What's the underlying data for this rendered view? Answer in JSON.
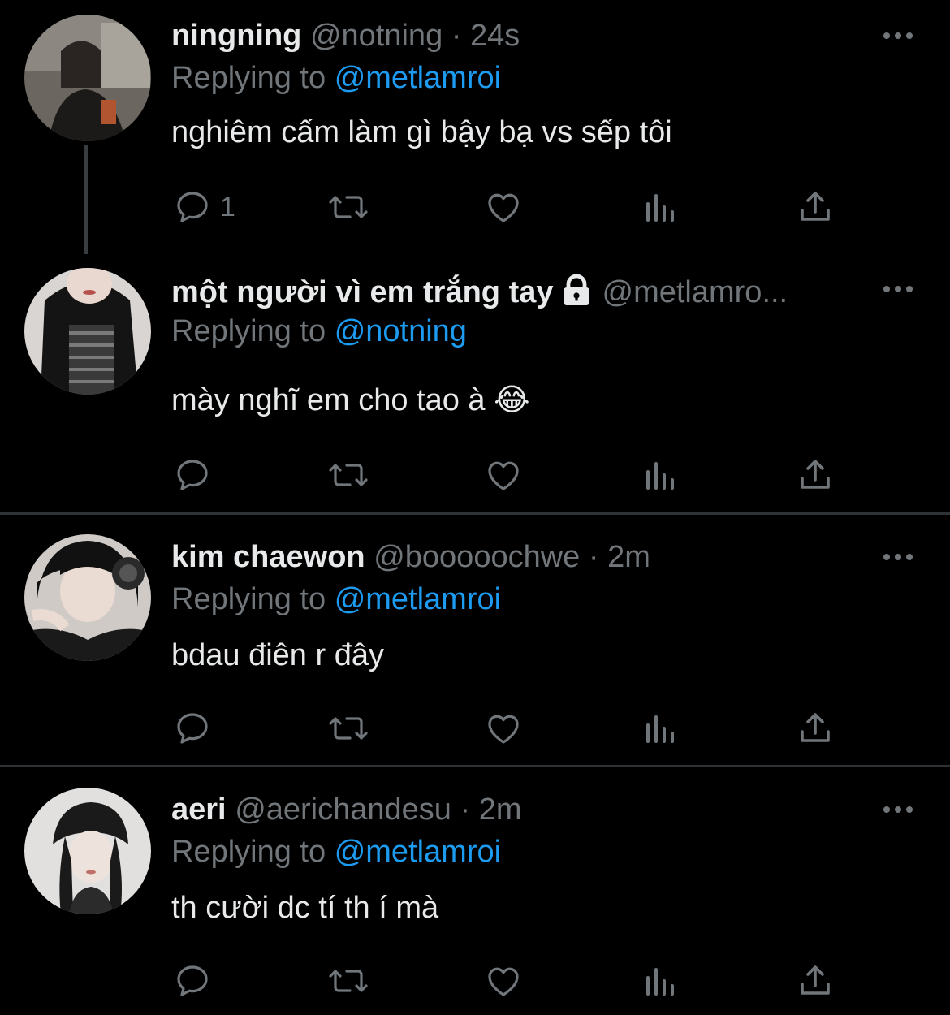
{
  "tweets": [
    {
      "name": "ningning",
      "handle": "@notning",
      "time": "· 24s",
      "replying_prefix": "Replying to",
      "replying_to": "@metlamroi",
      "text": "nghiêm cấm làm gì bậy bạ vs sếp tôi",
      "reply_count": "1"
    },
    {
      "name": "một người vì em trắng tay",
      "handle": "@metlamro...",
      "time": "",
      "protected": true,
      "replying_prefix": "Replying to",
      "replying_to": "@notning",
      "text": "mày nghĩ em cho tao à 😂",
      "reply_count": ""
    },
    {
      "name": "kim chaewon",
      "handle": "@booooochwe",
      "time": "· 2m",
      "replying_prefix": "Replying to",
      "replying_to": "@metlamroi",
      "text": "bdau điên r đây",
      "reply_count": ""
    },
    {
      "name": "aeri",
      "handle": "@aerichandesu",
      "time": "· 2m",
      "replying_prefix": "Replying to",
      "replying_to": "@metlamroi",
      "text": "th cười dc tí th í mà",
      "reply_count": ""
    }
  ],
  "icons": {
    "reply": "reply-icon",
    "retweet": "retweet-icon",
    "like": "heart-icon",
    "views": "views-icon",
    "share": "share-icon",
    "more": "more-icon",
    "lock": "lock-icon"
  },
  "colors": {
    "background": "#000000",
    "text": "#e7e9ea",
    "muted": "#71767b",
    "accent": "#1d9bf0",
    "divider": "#2f3336"
  }
}
